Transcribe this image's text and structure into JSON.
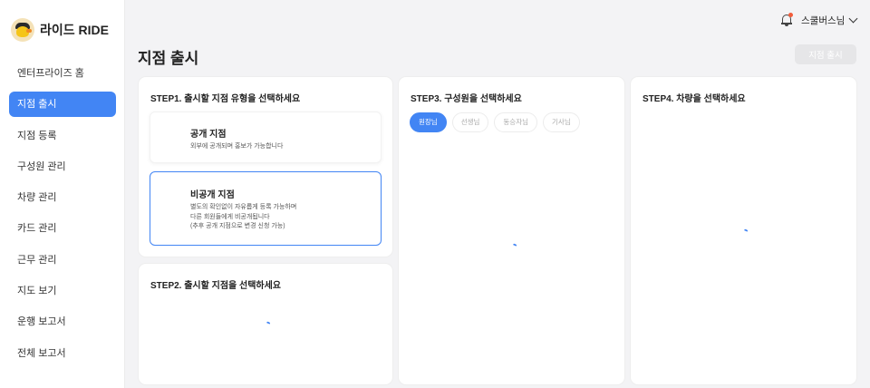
{
  "brand": {
    "name": "라이드 RIDE",
    "logo_icon": "duck-logo-icon"
  },
  "sidebar": {
    "items": [
      {
        "label": "엔터프라이즈 홈",
        "active": false
      },
      {
        "label": "지점 출시",
        "active": true
      },
      {
        "label": "지점 등록",
        "active": false
      },
      {
        "label": "구성원 관리",
        "active": false
      },
      {
        "label": "차량 관리",
        "active": false
      },
      {
        "label": "카드 관리",
        "active": false
      },
      {
        "label": "근무 관리",
        "active": false
      },
      {
        "label": "지도 보기",
        "active": false
      },
      {
        "label": "운행 보고서",
        "active": false
      },
      {
        "label": "전체 보고서",
        "active": false
      }
    ]
  },
  "header": {
    "user_name": "스쿨버스님",
    "notification_icon": "bell-icon",
    "dropdown_icon": "chevron-down-icon"
  },
  "page": {
    "title": "지점 출시",
    "release_button": "지점 출시"
  },
  "step1": {
    "title": "STEP1. 출시할 지점 유형을 선택하세요",
    "options": [
      {
        "title": "공개 지점",
        "desc": [
          "외부에 공개되며 홍보가 가능합니다"
        ]
      },
      {
        "title": "비공개 지점",
        "desc": [
          "별도의 확인없이 자유롭게 등록 가능하며",
          "다른 회원들에게 비공개됩니다",
          "(추후 공개 지점으로 변경 신청 가능)"
        ]
      }
    ]
  },
  "step2": {
    "title": "STEP2. 출시할 지점을 선택하세요"
  },
  "step3": {
    "title": "STEP3. 구성원을 선택하세요",
    "tabs": [
      {
        "label": "원장님",
        "active": true
      },
      {
        "label": "선생님",
        "active": false
      },
      {
        "label": "동승자님",
        "active": false
      },
      {
        "label": "기사님",
        "active": false
      }
    ]
  },
  "step4": {
    "title": "STEP4. 차량을 선택하세요"
  },
  "colors": {
    "accent": "#4285f4",
    "background": "#f3f3f5",
    "disabled_button": "#e6e6e8"
  }
}
